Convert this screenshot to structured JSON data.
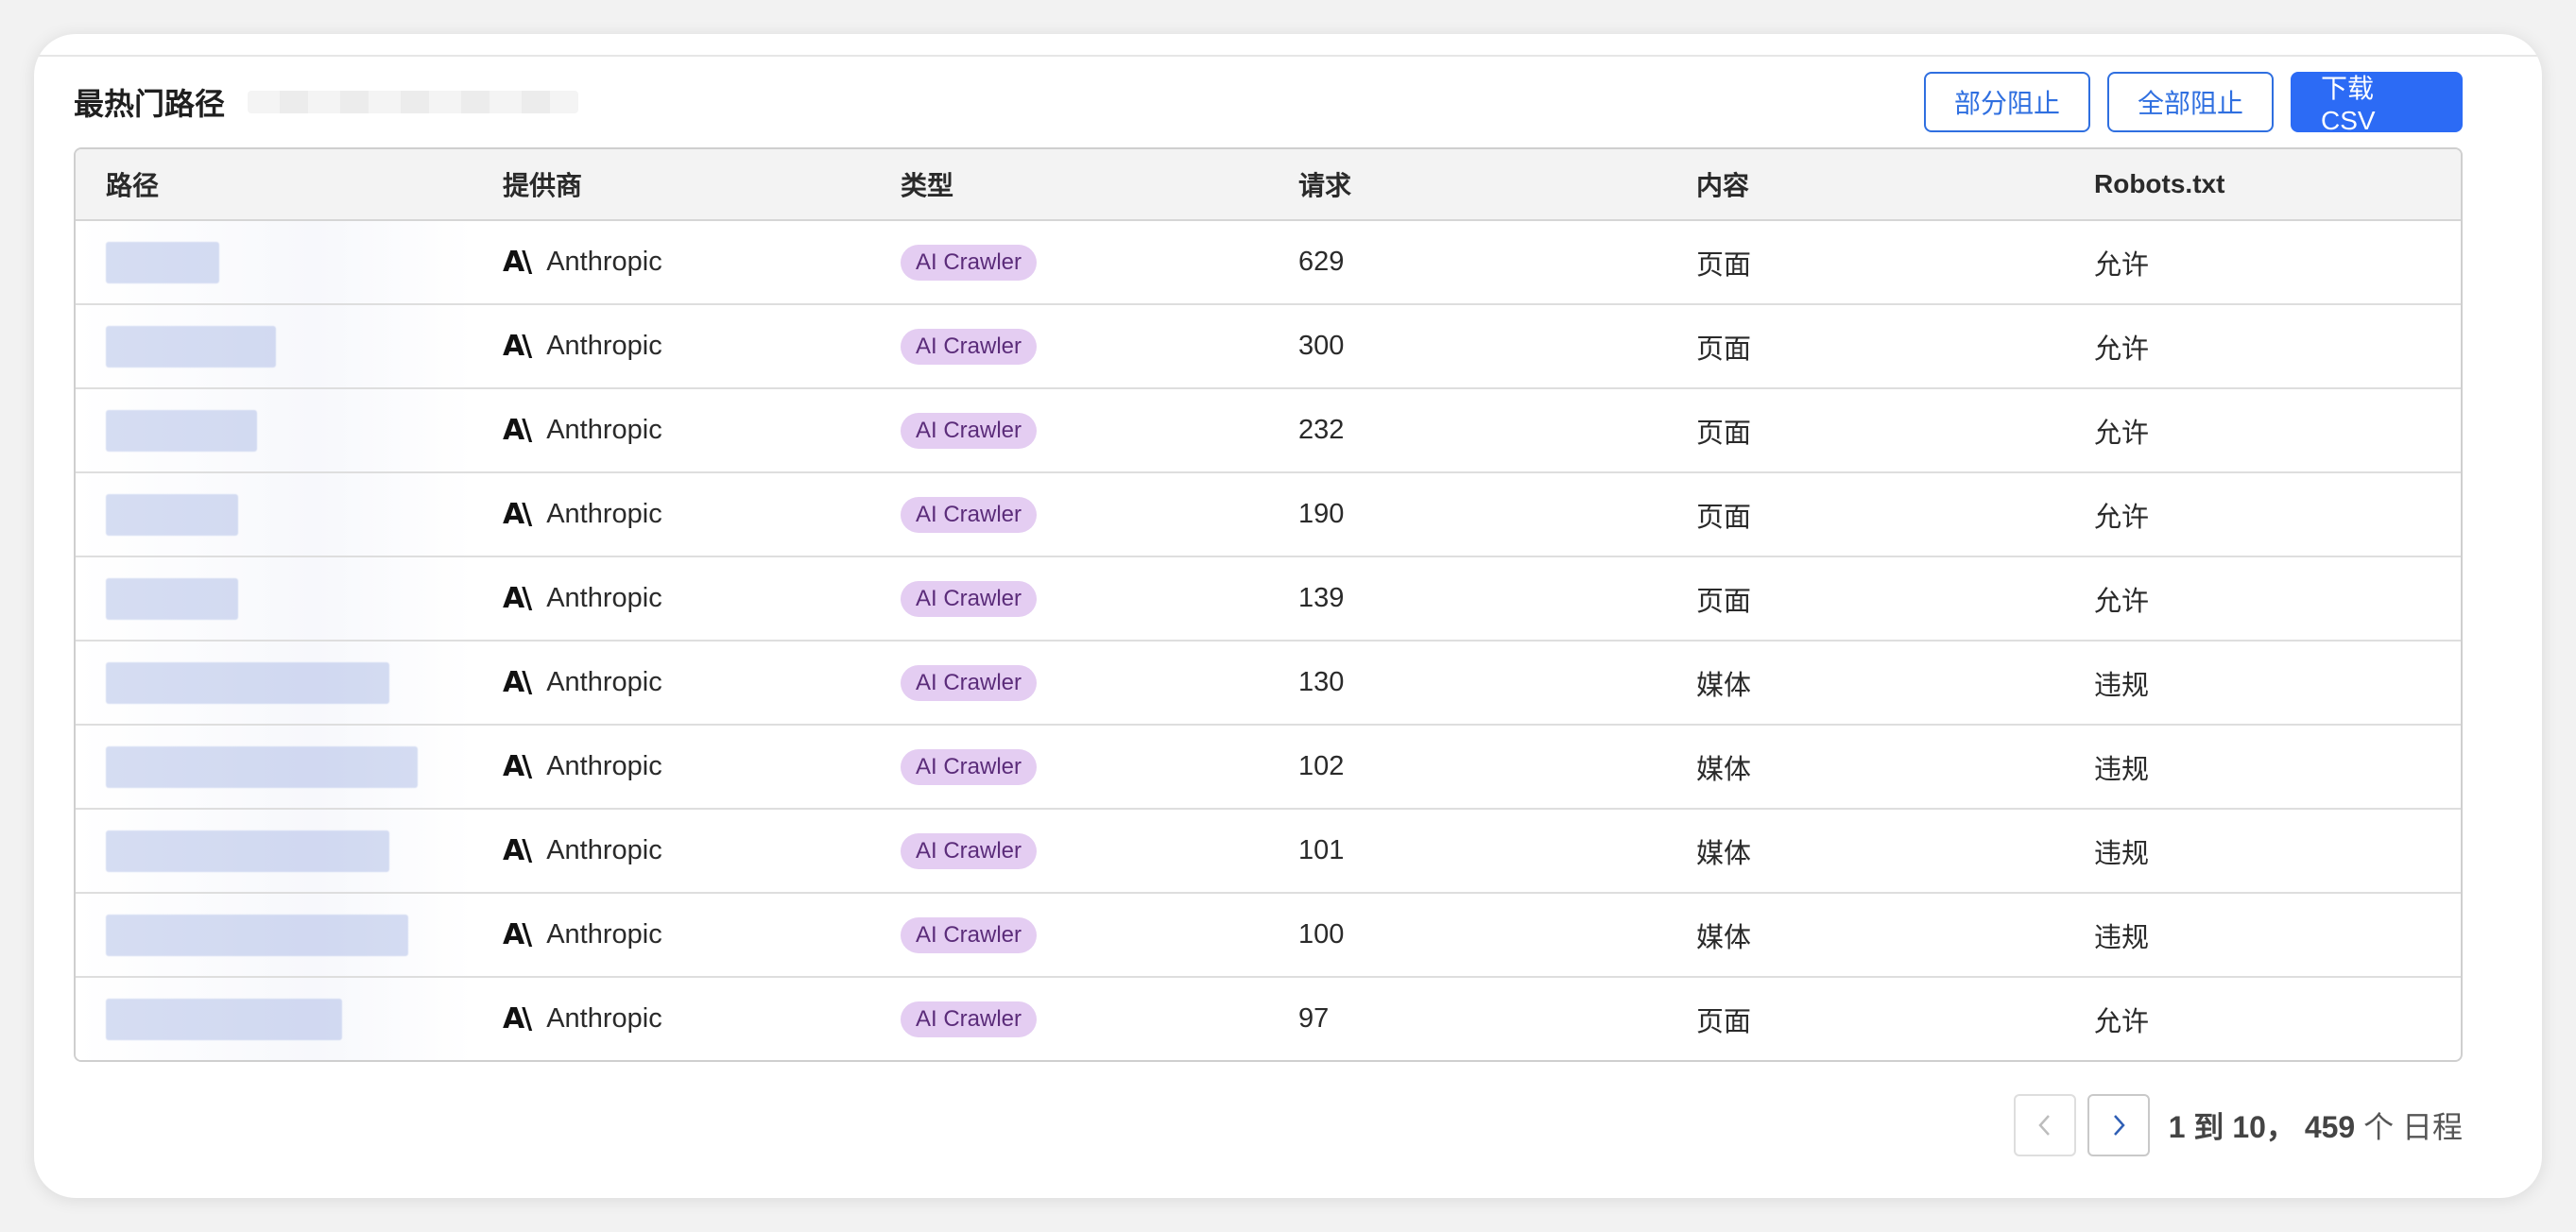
{
  "header": {
    "title": "最热门路径",
    "partial_block_label": "部分阻止",
    "block_all_label": "全部阻止",
    "download_label": "下载 CSV"
  },
  "table": {
    "columns": [
      "路径",
      "提供商",
      "类型",
      "请求",
      "内容",
      "Robots.txt"
    ],
    "rows": [
      {
        "provider": "Anthropic",
        "type": "AI Crawler",
        "requests": "629",
        "content": "页面",
        "robots": "允许"
      },
      {
        "provider": "Anthropic",
        "type": "AI Crawler",
        "requests": "300",
        "content": "页面",
        "robots": "允许"
      },
      {
        "provider": "Anthropic",
        "type": "AI Crawler",
        "requests": "232",
        "content": "页面",
        "robots": "允许"
      },
      {
        "provider": "Anthropic",
        "type": "AI Crawler",
        "requests": "190",
        "content": "页面",
        "robots": "允许"
      },
      {
        "provider": "Anthropic",
        "type": "AI Crawler",
        "requests": "139",
        "content": "页面",
        "robots": "允许"
      },
      {
        "provider": "Anthropic",
        "type": "AI Crawler",
        "requests": "130",
        "content": "媒体",
        "robots": "违规"
      },
      {
        "provider": "Anthropic",
        "type": "AI Crawler",
        "requests": "102",
        "content": "媒体",
        "robots": "违规"
      },
      {
        "provider": "Anthropic",
        "type": "AI Crawler",
        "requests": "101",
        "content": "媒体",
        "robots": "违规"
      },
      {
        "provider": "Anthropic",
        "type": "AI Crawler",
        "requests": "100",
        "content": "媒体",
        "robots": "违规"
      },
      {
        "provider": "Anthropic",
        "type": "AI Crawler",
        "requests": "97",
        "content": "页面",
        "robots": "允许"
      }
    ]
  },
  "pagination": {
    "range_start": "1",
    "range_to": "到",
    "range_end": "10",
    "separator": "，",
    "total": "459",
    "unit": "个 日程"
  },
  "icons": {
    "provider_logo": "anthropic-logo-icon",
    "prev": "chevron-left-icon",
    "next": "chevron-right-icon"
  },
  "colors": {
    "primary": "#2c6bf5",
    "badge_bg": "#e4cdf2",
    "badge_text": "#5b2c7a"
  }
}
